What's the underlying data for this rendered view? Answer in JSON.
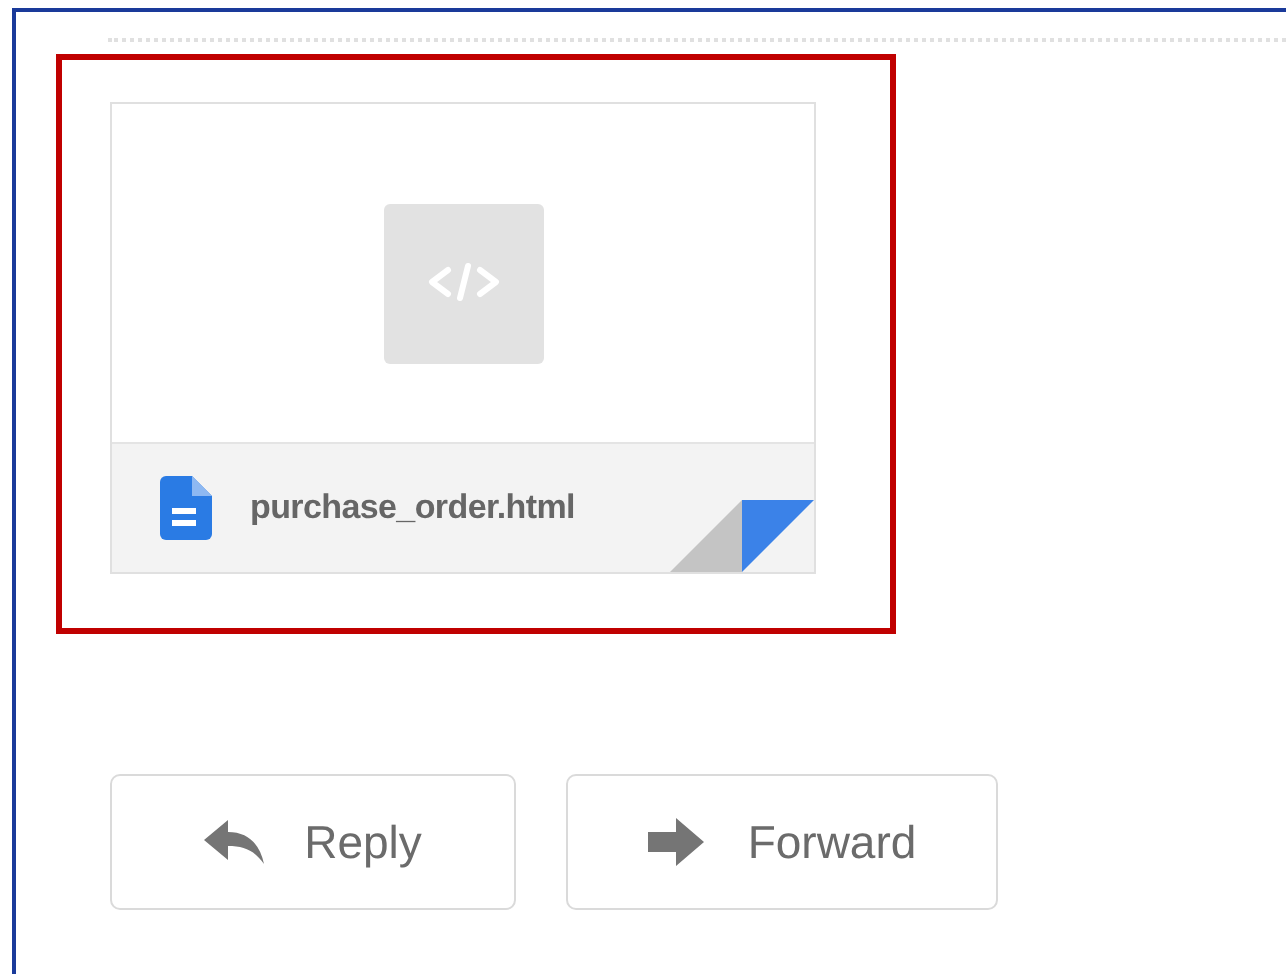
{
  "attachment": {
    "filename": "purchase_order.html"
  },
  "buttons": [
    {
      "label": "Reply",
      "kind": "reply"
    },
    {
      "label": "Forward",
      "kind": "forward"
    }
  ]
}
